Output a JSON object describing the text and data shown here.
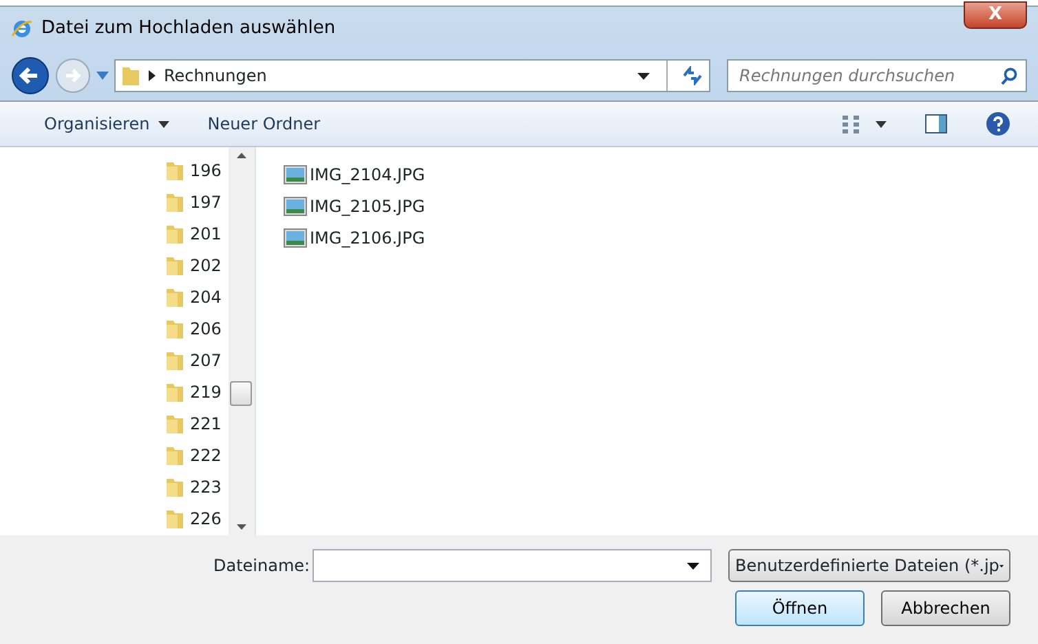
{
  "window": {
    "title": "Datei zum Hochladen auswählen",
    "close": "X"
  },
  "address": {
    "path": "Rechnungen",
    "search_placeholder": "Rechnungen durchsuchen"
  },
  "toolbar": {
    "organize": "Organisieren",
    "new_folder": "Neuer Ordner"
  },
  "folders": [
    "196",
    "197",
    "201",
    "202",
    "204",
    "206",
    "207",
    "219",
    "221",
    "222",
    "223",
    "226"
  ],
  "files": [
    "IMG_2104.JPG",
    "IMG_2105.JPG",
    "IMG_2106.JPG"
  ],
  "footer": {
    "filename_label": "Dateiname:",
    "filetype": "Benutzerdefinierte Dateien (*.jp",
    "open": "Öffnen",
    "cancel": "Abbrechen"
  }
}
